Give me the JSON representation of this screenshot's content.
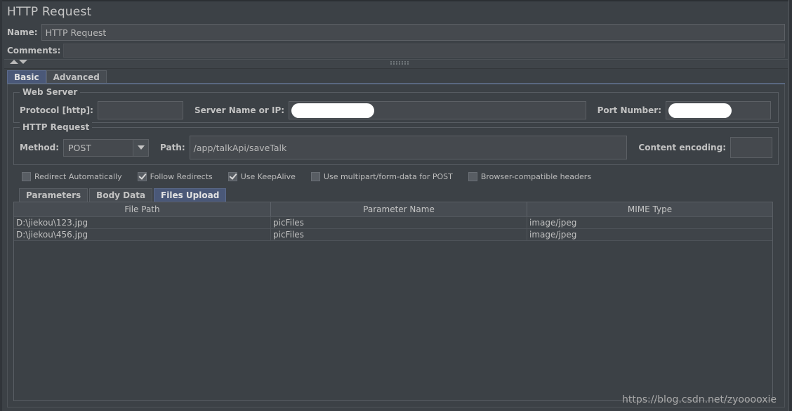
{
  "window": {
    "title": "HTTP Request"
  },
  "form": {
    "name_label": "Name:",
    "name_value": "HTTP Request",
    "comments_label": "Comments:",
    "comments_value": ""
  },
  "main_tabs": [
    {
      "label": "Basic",
      "selected": true
    },
    {
      "label": "Advanced",
      "selected": false
    }
  ],
  "web_server": {
    "group_title": "Web Server",
    "protocol_label": "Protocol [http]:",
    "protocol_value": "",
    "server_label": "Server Name or IP:",
    "server_value": "",
    "port_label": "Port Number:",
    "port_value": ""
  },
  "http_request": {
    "group_title": "HTTP Request",
    "method_label": "Method:",
    "method_value": "POST",
    "path_label": "Path:",
    "path_value": "/app/talkApi/saveTalk",
    "encoding_label": "Content encoding:",
    "encoding_value": ""
  },
  "options": [
    {
      "label": "Redirect Automatically",
      "checked": false
    },
    {
      "label": "Follow Redirects",
      "checked": true
    },
    {
      "label": "Use KeepAlive",
      "checked": true
    },
    {
      "label": "Use multipart/form-data for POST",
      "checked": false
    },
    {
      "label": "Browser-compatible headers",
      "checked": false
    }
  ],
  "sub_tabs": [
    {
      "label": "Parameters",
      "selected": false
    },
    {
      "label": "Body Data",
      "selected": false
    },
    {
      "label": "Files Upload",
      "selected": true
    }
  ],
  "files_table": {
    "columns": [
      "File Path",
      "Parameter Name",
      "MIME Type"
    ],
    "rows": [
      [
        "D:\\jiekou\\123.jpg",
        "picFiles",
        "image/jpeg"
      ],
      [
        "D:\\jiekou\\456.jpg",
        "picFiles",
        "image/jpeg"
      ]
    ]
  },
  "watermark": "https://blog.csdn.net/zyooooxie",
  "colors": {
    "background": "#3c4146",
    "panel": "#3c4146",
    "field": "#45494e",
    "border": "#5a5f65",
    "accent_selected_tab": "#4a5878",
    "text": "#c0c0c0",
    "redaction": "#ffffff"
  }
}
